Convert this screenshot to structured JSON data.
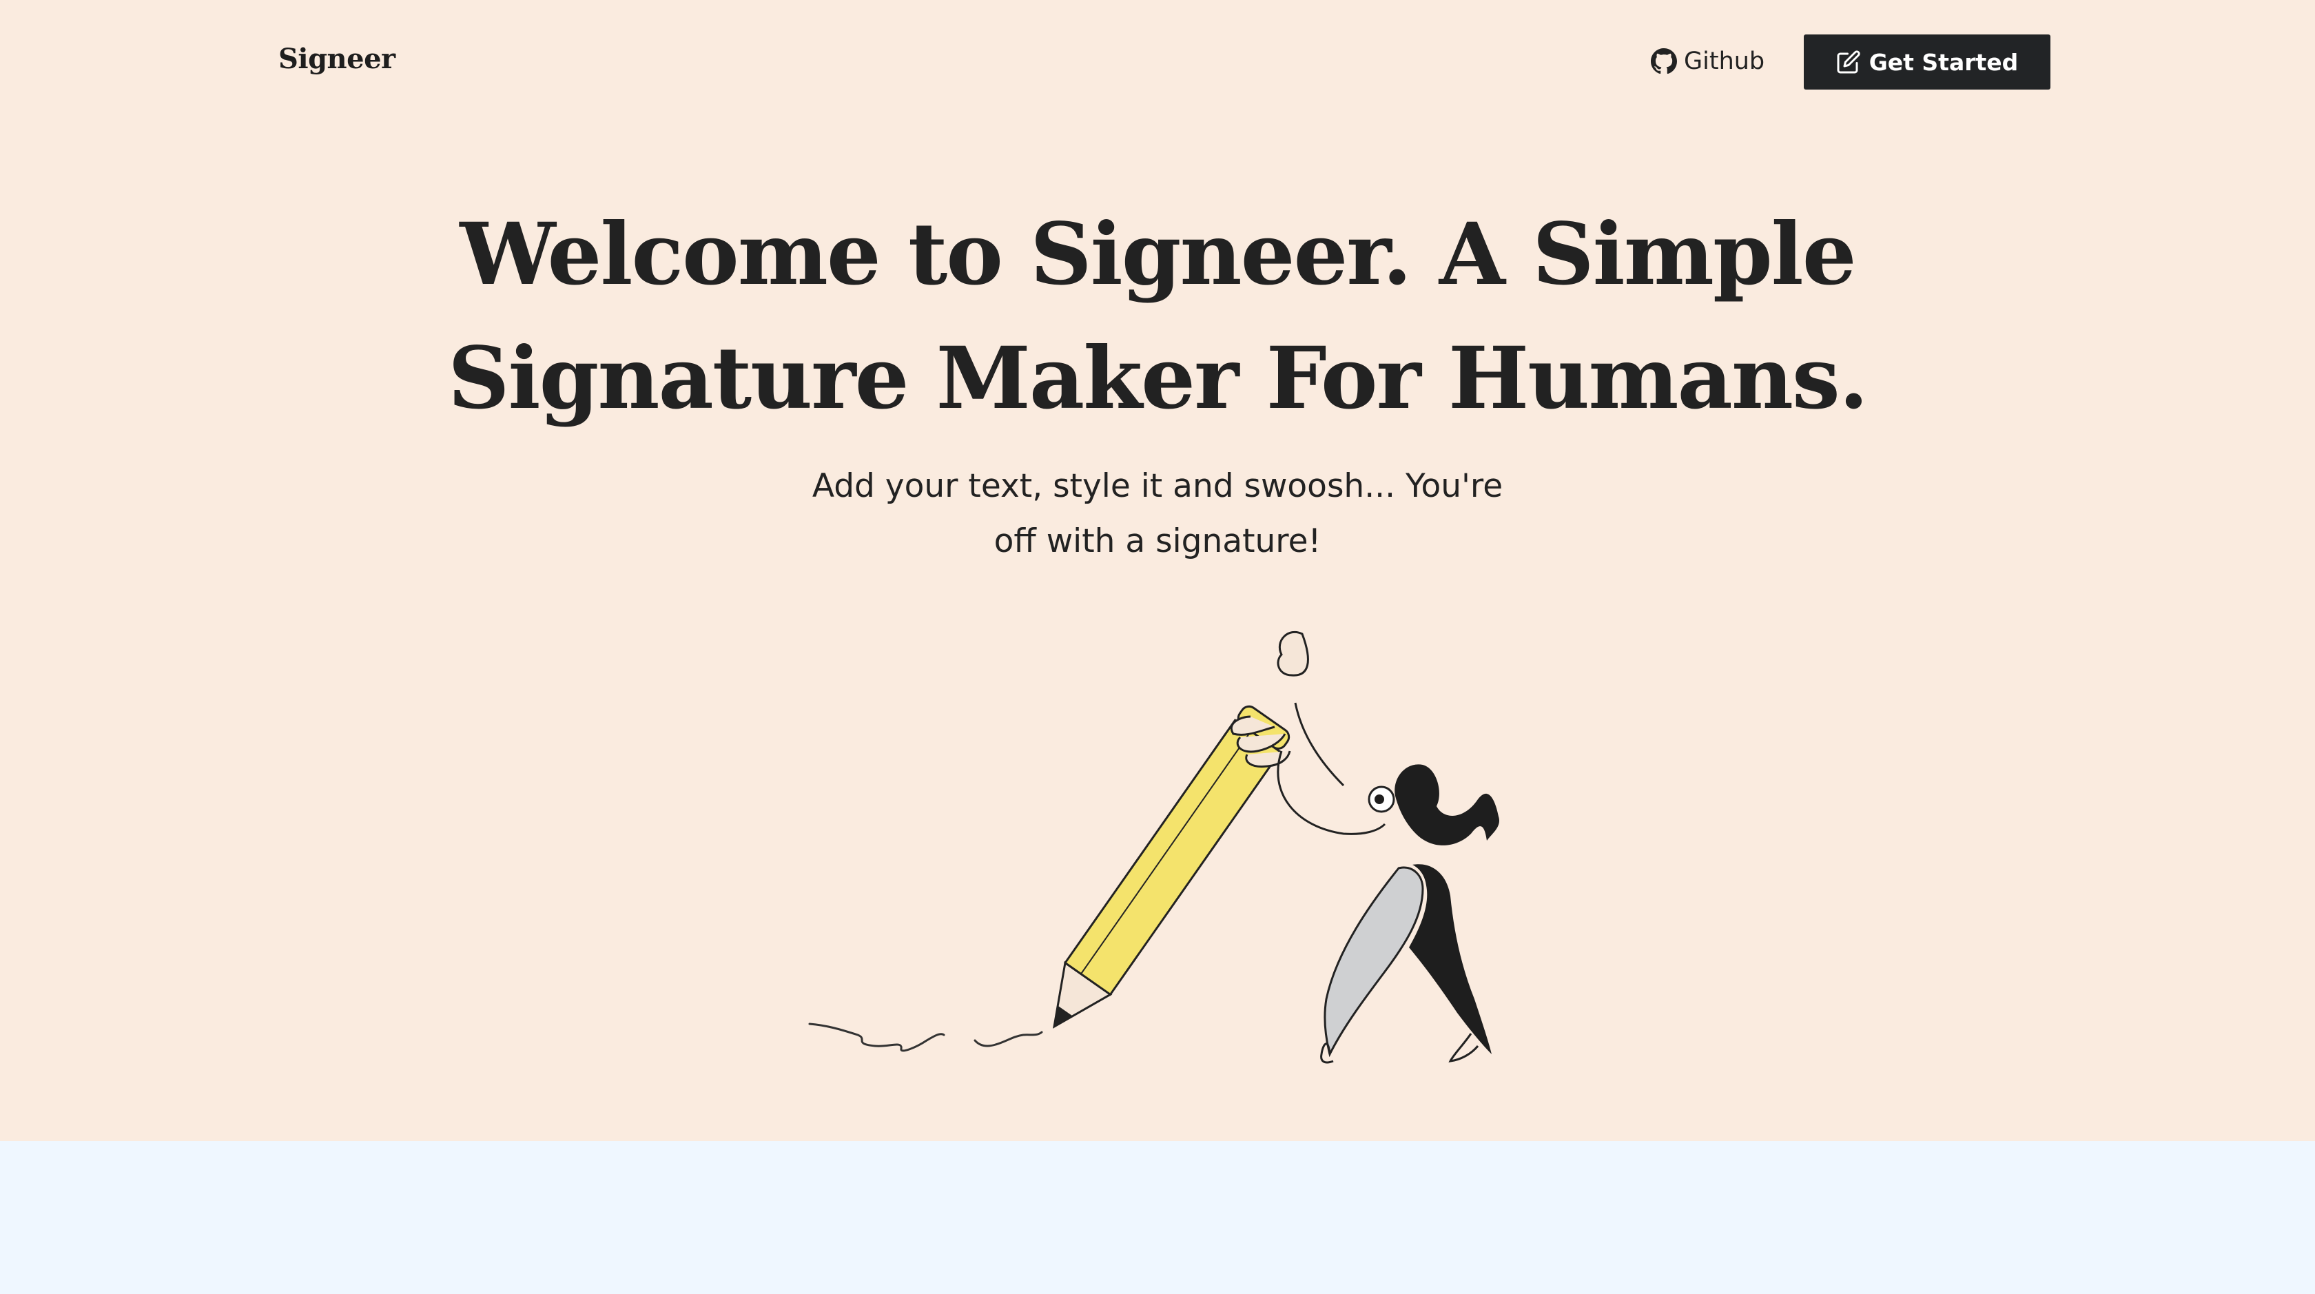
{
  "nav": {
    "logo": "Signeer",
    "github_label": "Github",
    "github_icon": "github-icon",
    "cta_label": "Get Started",
    "cta_icon": "edit-icon"
  },
  "hero": {
    "headline": "Welcome to Signeer. A Simple Signature Maker For Humans.",
    "subtitle": "Add your text, style it and swoosh... You're off with a signature!",
    "illustration": "person-pencil-illustration"
  },
  "colors": {
    "hero_bg": "#faebdf",
    "below_bg": "#eff7ff",
    "button_bg": "#222426",
    "text": "#222222",
    "pencil_yellow": "#f4e36c"
  }
}
